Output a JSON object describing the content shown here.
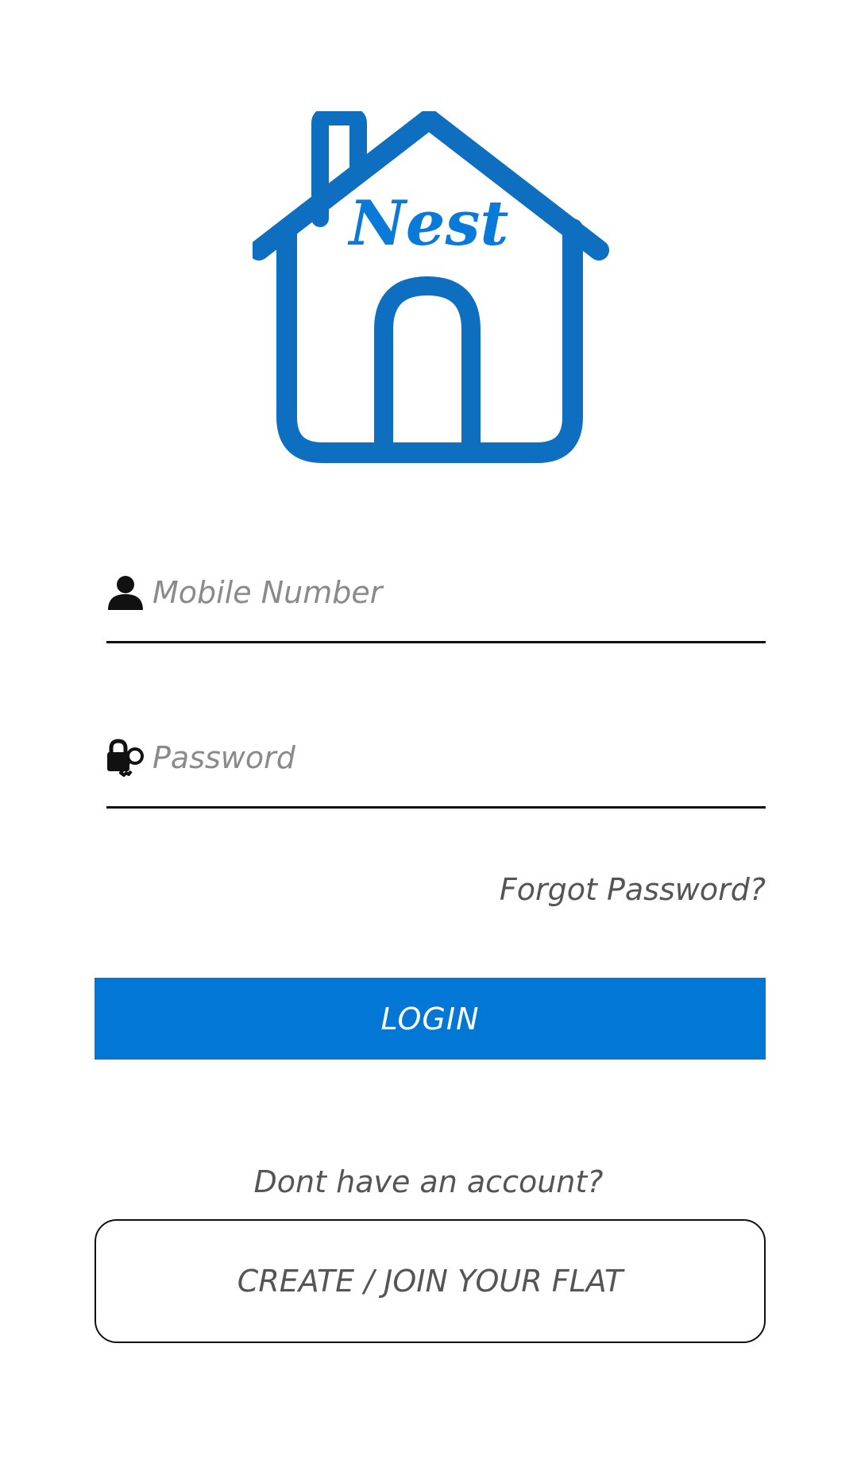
{
  "app": {
    "logo_text": "Nest",
    "brand_color": "#0277d6"
  },
  "form": {
    "mobile": {
      "icon": "person-icon",
      "placeholder": "Mobile Number",
      "value": ""
    },
    "password": {
      "icon": "lock-key-icon",
      "placeholder": "Password",
      "value": ""
    },
    "forgot_label": "Forgot Password?",
    "login_label": "LOGIN"
  },
  "signup": {
    "prompt": "Dont have an account?",
    "create_label": "CREATE / JOIN YOUR FLAT"
  }
}
